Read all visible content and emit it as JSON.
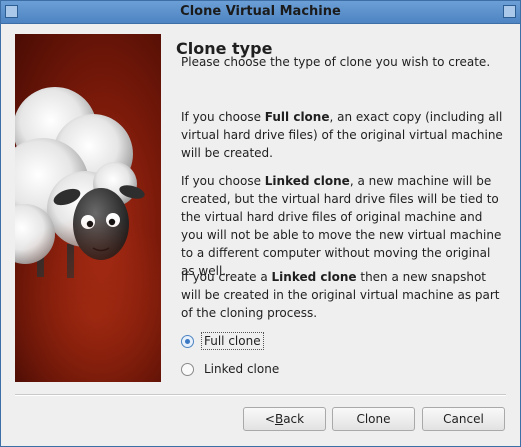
{
  "window": {
    "title": "Clone Virtual Machine"
  },
  "page": {
    "heading": "Clone type",
    "intro": "Please choose the type of clone you wish to create.",
    "full_clone_desc": {
      "pre": "If you choose ",
      "bold": "Full clone",
      "post": ", an exact copy (including all virtual hard drive files) of the original virtual machine will be created."
    },
    "linked_clone_desc": {
      "pre": "If you choose ",
      "bold": "Linked clone",
      "post": ", a new machine will be created, but the virtual hard drive files will be tied to the virtual hard drive files of original machine and you will not be able to move the new virtual machine to a different computer without moving the original as well."
    },
    "snapshot_desc": {
      "pre": "If you create a ",
      "bold": "Linked clone",
      "post": " then a new snapshot will be created in the original virtual machine as part of the cloning process."
    }
  },
  "options": {
    "full_clone": {
      "label": "Full clone",
      "checked": true
    },
    "linked_clone": {
      "label": "Linked clone",
      "checked": false
    }
  },
  "buttons": {
    "back": {
      "prefix": "< ",
      "mnemonic": "B",
      "rest": "ack"
    },
    "clone": "Clone",
    "cancel": "Cancel"
  },
  "icons": {
    "wizard_image": "sheep-mascot-image"
  }
}
